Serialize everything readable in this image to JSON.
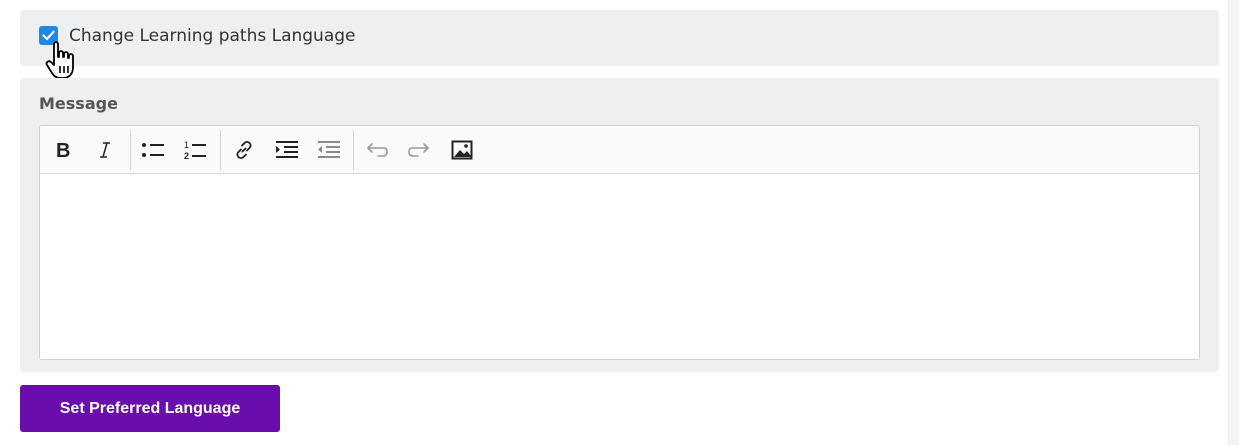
{
  "language_option": {
    "checkbox_checked": true,
    "label": "Change Learning paths Language"
  },
  "message": {
    "label": "Message",
    "toolbar": [
      {
        "icon": "bold-icon",
        "title": "Bold"
      },
      {
        "icon": "italic-icon",
        "title": "Italic"
      },
      {
        "icon": "bulleted-list-icon",
        "title": "Bulleted List"
      },
      {
        "icon": "numbered-list-icon",
        "title": "Numbered List"
      },
      {
        "icon": "link-icon",
        "title": "Link"
      },
      {
        "icon": "indent-icon",
        "title": "Increase Indent"
      },
      {
        "icon": "outdent-icon",
        "title": "Decrease Indent"
      },
      {
        "icon": "undo-icon",
        "title": "Undo"
      },
      {
        "icon": "redo-icon",
        "title": "Redo"
      },
      {
        "icon": "image-icon",
        "title": "Insert Image"
      }
    ],
    "content": ""
  },
  "submit_button": {
    "label": "Set Preferred Language"
  },
  "colors": {
    "accent": "#6a0dad",
    "checkbox": "#1e88e5",
    "panel_bg": "#eeeff1"
  }
}
